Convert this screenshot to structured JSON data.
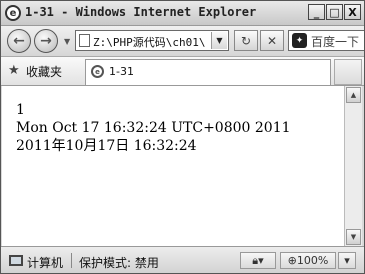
{
  "window": {
    "title": "1-31 - Windows Internet Explorer",
    "minimize_glyph": "_",
    "maximize_glyph": "□",
    "close_glyph": "X"
  },
  "toolbar": {
    "back_glyph": "←",
    "forward_glyph": "→",
    "dropdown_glyph": "▼",
    "address": "Z:\\PHP源代码\\ch01\\",
    "refresh_glyph": "↻",
    "stop_glyph": "✕",
    "search_placeholder": "百度一下"
  },
  "favorites": {
    "label": "收藏夹",
    "star_glyph": "★"
  },
  "tab": {
    "label": "1-31"
  },
  "content": {
    "lines": [
      "1",
      "Mon Oct 17 16:32:24 UTC+0800 2011",
      "2011年10月17日 16:32:24"
    ]
  },
  "scrollbar": {
    "up_glyph": "▲",
    "down_glyph": "▼"
  },
  "statusbar": {
    "zone": "计算机",
    "protected_mode": "保护模式: 禁用",
    "zoom": "100%",
    "caret": "▾"
  }
}
